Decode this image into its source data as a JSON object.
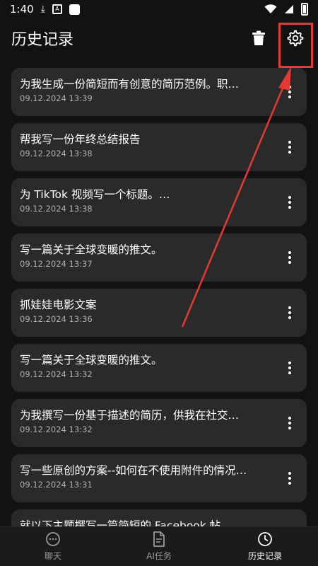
{
  "status_bar": {
    "time": "1:40"
  },
  "app_bar": {
    "title": "历史记录"
  },
  "history": [
    {
      "title": "为我生成一份简短而有创意的简历范例。职…",
      "date": "09.12.2024 13:39"
    },
    {
      "title": "帮我写一份年终总结报告",
      "date": "09.12.2024 13:38"
    },
    {
      "title": "为 TikTok 视频写一个标题。…",
      "date": "09.12.2024 13:38"
    },
    {
      "title": "写一篇关于全球变暖的推文。",
      "date": "09.12.2024 13:37"
    },
    {
      "title": "抓娃娃电影文案",
      "date": "09.12.2024 13:36"
    },
    {
      "title": "写一篇关于全球变暖的推文。",
      "date": "09.12.2024 13:32"
    },
    {
      "title": "为我撰写一份基于描述的简历，供我在社交…",
      "date": "09.12.2024 13:32"
    },
    {
      "title": "写一些原创的方案--如何在不使用附件的情况…",
      "date": "09.12.2024 13:31"
    },
    {
      "title": "就以下主题撰写一篇简短的 Facebook 帖…",
      "date": ""
    }
  ],
  "bottom_nav": {
    "items": [
      {
        "label": "聊天",
        "icon": "chat-bubble-icon",
        "active": false
      },
      {
        "label": "AI任务",
        "icon": "document-icon",
        "active": false
      },
      {
        "label": "历史记录",
        "icon": "clock-icon",
        "active": true
      }
    ]
  },
  "colors": {
    "background": "#121212",
    "card": "#2a2a2a",
    "annotation": "#e53935"
  }
}
